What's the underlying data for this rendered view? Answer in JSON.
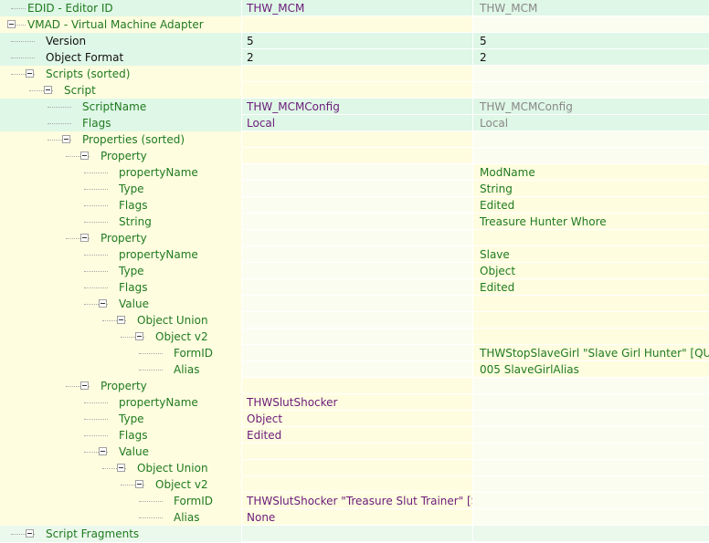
{
  "rows": [
    {
      "label": "EDID - Editor ID",
      "level": 0,
      "toggle": false,
      "labelColor": "#1f7a1f",
      "bg": [
        "#dff7e6",
        "#dff7e6",
        "#dff7e6"
      ],
      "value1": "THW_MCM",
      "value1Color": "#6a1b7a",
      "value2": "THW_MCM",
      "value2Color": "#888888"
    },
    {
      "label": "VMAD - Virtual Machine Adapter",
      "level": 0,
      "toggle": true,
      "labelColor": "#1f7a1f",
      "bg": [
        "#fffde0",
        "#fffde0",
        "#fcfdf1"
      ],
      "value1": "",
      "value1Color": "#111111",
      "value2": "",
      "value2Color": "#111111"
    },
    {
      "label": "Version",
      "level": 1,
      "toggle": false,
      "labelColor": "#111111",
      "bg": [
        "#dff7e6",
        "#dff7e6",
        "#dff7e6"
      ],
      "value1": "5",
      "value1Color": "#111111",
      "value2": "5",
      "value2Color": "#111111"
    },
    {
      "label": "Object Format",
      "level": 1,
      "toggle": false,
      "labelColor": "#111111",
      "bg": [
        "#dff7e6",
        "#dff7e6",
        "#dff7e6"
      ],
      "value1": "2",
      "value1Color": "#111111",
      "value2": "2",
      "value2Color": "#111111"
    },
    {
      "label": "Scripts (sorted)",
      "level": 1,
      "toggle": true,
      "labelColor": "#1f7a1f",
      "bg": [
        "#fffde0",
        "#fffde0",
        "#fcfdf1"
      ],
      "value1": "",
      "value1Color": "#111111",
      "value2": "",
      "value2Color": "#111111"
    },
    {
      "label": "Script",
      "level": 2,
      "toggle": true,
      "labelColor": "#1f7a1f",
      "bg": [
        "#fffde0",
        "#fffde0",
        "#fcfdf1"
      ],
      "value1": "",
      "value1Color": "#111111",
      "value2": "",
      "value2Color": "#111111"
    },
    {
      "label": "ScriptName",
      "level": 3,
      "toggle": false,
      "labelColor": "#1f7a1f",
      "bg": [
        "#dff7e6",
        "#dff7e6",
        "#dff7e6"
      ],
      "value1": "THW_MCMConfig",
      "value1Color": "#6a1b7a",
      "value2": "THW_MCMConfig",
      "value2Color": "#888888"
    },
    {
      "label": "Flags",
      "level": 3,
      "toggle": false,
      "labelColor": "#1f7a1f",
      "bg": [
        "#dff7e6",
        "#dff7e6",
        "#dff7e6"
      ],
      "value1": "Local",
      "value1Color": "#6a1b7a",
      "value2": "Local",
      "value2Color": "#888888"
    },
    {
      "label": "Properties (sorted)",
      "level": 3,
      "toggle": true,
      "labelColor": "#1f7a1f",
      "bg": [
        "#fffde0",
        "#fffde0",
        "#fcfdf1"
      ],
      "value1": "",
      "value1Color": "#111111",
      "value2": "",
      "value2Color": "#111111"
    },
    {
      "label": "Property",
      "level": 4,
      "toggle": true,
      "labelColor": "#1f7a1f",
      "bg": [
        "#fffde0",
        "#fffde0",
        "#fcfdf1"
      ],
      "value1": "",
      "value1Color": "#111111",
      "value2": "",
      "value2Color": "#111111"
    },
    {
      "label": "propertyName",
      "level": 5,
      "toggle": false,
      "labelColor": "#1f7a1f",
      "bg": [
        "#fffde0",
        "#fcfdf1",
        "#fffde0"
      ],
      "value1": "",
      "value1Color": "#111111",
      "value2": "ModName",
      "value2Color": "#1f7a1f"
    },
    {
      "label": "Type",
      "level": 5,
      "toggle": false,
      "labelColor": "#1f7a1f",
      "bg": [
        "#fffde0",
        "#fcfdf1",
        "#fffde0"
      ],
      "value1": "",
      "value1Color": "#111111",
      "value2": "String",
      "value2Color": "#1f7a1f"
    },
    {
      "label": "Flags",
      "level": 5,
      "toggle": false,
      "labelColor": "#1f7a1f",
      "bg": [
        "#fffde0",
        "#fcfdf1",
        "#fffde0"
      ],
      "value1": "",
      "value1Color": "#111111",
      "value2": "Edited",
      "value2Color": "#1f7a1f"
    },
    {
      "label": "String",
      "level": 5,
      "toggle": false,
      "labelColor": "#1f7a1f",
      "bg": [
        "#fffde0",
        "#fcfdf1",
        "#fffde0"
      ],
      "value1": "",
      "value1Color": "#111111",
      "value2": "Treasure Hunter Whore",
      "value2Color": "#1f7a1f"
    },
    {
      "label": "Property",
      "level": 4,
      "toggle": true,
      "labelColor": "#1f7a1f",
      "bg": [
        "#fffde0",
        "#fcfdf1",
        "#fffde0"
      ],
      "value1": "",
      "value1Color": "#111111",
      "value2": "",
      "value2Color": "#111111"
    },
    {
      "label": "propertyName",
      "level": 5,
      "toggle": false,
      "labelColor": "#1f7a1f",
      "bg": [
        "#fffde0",
        "#fcfdf1",
        "#fffde0"
      ],
      "value1": "",
      "value1Color": "#111111",
      "value2": "Slave",
      "value2Color": "#1f7a1f"
    },
    {
      "label": "Type",
      "level": 5,
      "toggle": false,
      "labelColor": "#1f7a1f",
      "bg": [
        "#fffde0",
        "#fcfdf1",
        "#fffde0"
      ],
      "value1": "",
      "value1Color": "#111111",
      "value2": "Object",
      "value2Color": "#1f7a1f"
    },
    {
      "label": "Flags",
      "level": 5,
      "toggle": false,
      "labelColor": "#1f7a1f",
      "bg": [
        "#fffde0",
        "#fcfdf1",
        "#fffde0"
      ],
      "value1": "",
      "value1Color": "#111111",
      "value2": "Edited",
      "value2Color": "#1f7a1f"
    },
    {
      "label": "Value",
      "level": 5,
      "toggle": true,
      "labelColor": "#1f7a1f",
      "bg": [
        "#fffde0",
        "#fcfdf1",
        "#fffde0"
      ],
      "value1": "",
      "value1Color": "#111111",
      "value2": "",
      "value2Color": "#111111"
    },
    {
      "label": "Object Union",
      "level": 6,
      "toggle": true,
      "labelColor": "#1f7a1f",
      "bg": [
        "#fffde0",
        "#fcfdf1",
        "#fffde0"
      ],
      "value1": "",
      "value1Color": "#111111",
      "value2": "",
      "value2Color": "#111111"
    },
    {
      "label": "Object v2",
      "level": 7,
      "toggle": true,
      "labelColor": "#1f7a1f",
      "bg": [
        "#fffde0",
        "#fcfdf1",
        "#fffde0"
      ],
      "value1": "",
      "value1Color": "#111111",
      "value2": "",
      "value2Color": "#111111"
    },
    {
      "label": "FormID",
      "level": 8,
      "toggle": false,
      "labelColor": "#1f7a1f",
      "bg": [
        "#fffde0",
        "#fcfdf1",
        "#fffde0"
      ],
      "value1": "",
      "value1Color": "#111111",
      "value2": "THWStopSlaveGirl \"Slave Girl Hunter\" [QUST...",
      "value2Color": "#1f7a1f"
    },
    {
      "label": "Alias",
      "level": 8,
      "toggle": false,
      "labelColor": "#1f7a1f",
      "bg": [
        "#fffde0",
        "#fcfdf1",
        "#fffde0"
      ],
      "value1": "",
      "value1Color": "#111111",
      "value2": "005 SlaveGirlAlias",
      "value2Color": "#1f7a1f"
    },
    {
      "label": "Property",
      "level": 4,
      "toggle": true,
      "labelColor": "#1f7a1f",
      "bg": [
        "#fffde0",
        "#fffde0",
        "#fcfdf1"
      ],
      "value1": "",
      "value1Color": "#111111",
      "value2": "",
      "value2Color": "#111111"
    },
    {
      "label": "propertyName",
      "level": 5,
      "toggle": false,
      "labelColor": "#1f7a1f",
      "bg": [
        "#fffde0",
        "#fffde0",
        "#fcfdf1"
      ],
      "value1": "THWSlutShocker",
      "value1Color": "#6a1b7a",
      "value2": "",
      "value2Color": "#111111"
    },
    {
      "label": "Type",
      "level": 5,
      "toggle": false,
      "labelColor": "#1f7a1f",
      "bg": [
        "#fffde0",
        "#fffde0",
        "#fcfdf1"
      ],
      "value1": "Object",
      "value1Color": "#6a1b7a",
      "value2": "",
      "value2Color": "#111111"
    },
    {
      "label": "Flags",
      "level": 5,
      "toggle": false,
      "labelColor": "#1f7a1f",
      "bg": [
        "#fffde0",
        "#fffde0",
        "#fcfdf1"
      ],
      "value1": "Edited",
      "value1Color": "#6a1b7a",
      "value2": "",
      "value2Color": "#111111"
    },
    {
      "label": "Value",
      "level": 5,
      "toggle": true,
      "labelColor": "#1f7a1f",
      "bg": [
        "#fffde0",
        "#fffde0",
        "#fcfdf1"
      ],
      "value1": "",
      "value1Color": "#111111",
      "value2": "",
      "value2Color": "#111111"
    },
    {
      "label": "Object Union",
      "level": 6,
      "toggle": true,
      "labelColor": "#1f7a1f",
      "bg": [
        "#fffde0",
        "#fffde0",
        "#fcfdf1"
      ],
      "value1": "",
      "value1Color": "#111111",
      "value2": "",
      "value2Color": "#111111"
    },
    {
      "label": "Object v2",
      "level": 7,
      "toggle": true,
      "labelColor": "#1f7a1f",
      "bg": [
        "#fffde0",
        "#fffde0",
        "#fcfdf1"
      ],
      "value1": "",
      "value1Color": "#111111",
      "value2": "",
      "value2Color": "#111111"
    },
    {
      "label": "FormID",
      "level": 8,
      "toggle": false,
      "labelColor": "#1f7a1f",
      "bg": [
        "#fffde0",
        "#fffde0",
        "#fcfdf1"
      ],
      "value1": "THWSlutShocker \"Treasure Slut Trainer\" [SPE...",
      "value1Color": "#6a1b7a",
      "value2": "",
      "value2Color": "#111111"
    },
    {
      "label": "Alias",
      "level": 8,
      "toggle": false,
      "labelColor": "#1f7a1f",
      "bg": [
        "#fffde0",
        "#fffde0",
        "#fcfdf1"
      ],
      "value1": "None",
      "value1Color": "#6a1b7a",
      "value2": "",
      "value2Color": "#111111"
    },
    {
      "label": "Script Fragments",
      "level": 1,
      "toggle": true,
      "labelColor": "#1f7a1f",
      "bg": [
        "#ebf8ec",
        "#ebf8ec",
        "#ebf8ec"
      ],
      "value1": "",
      "value1Color": "#111111",
      "value2": "",
      "value2Color": "#111111"
    }
  ]
}
